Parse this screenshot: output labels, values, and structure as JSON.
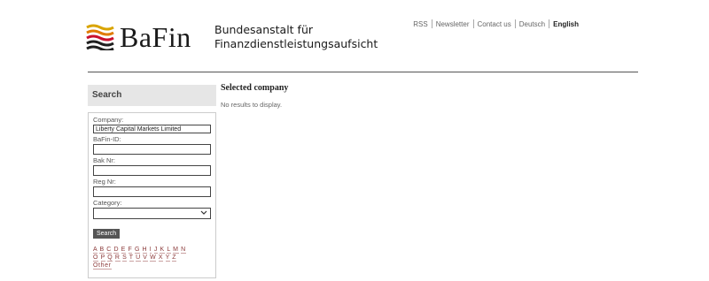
{
  "header": {
    "logo_word": "BaFin",
    "logo_sub_line1": "Bundesanstalt für",
    "logo_sub_line2": "Finanzdienstleistungsaufsicht",
    "nav": [
      "RSS",
      "Newsletter",
      "Contact us",
      "Deutsch",
      "English"
    ],
    "active_nav": "English"
  },
  "sidebar": {
    "title": "Search",
    "company_label": "Company:",
    "company_value": "Liberty Capital Markets Limited",
    "bafin_id_label": "BaFin-ID:",
    "bafin_id_value": "",
    "bak_label": "Bak Nr:",
    "bak_value": "",
    "reg_label": "Reg Nr:",
    "reg_value": "",
    "category_label": "Category:",
    "category_value": "",
    "search_button": "Search",
    "alphabet_row1": [
      "A",
      "B",
      "C",
      "D",
      "E",
      "F",
      "G",
      "H",
      "I",
      "J",
      "K",
      "L",
      "M",
      "N"
    ],
    "alphabet_row2": [
      "O",
      "P",
      "Q",
      "R",
      "S",
      "T",
      "U",
      "V",
      "W",
      "X",
      "Y",
      "Z"
    ],
    "other_link": "Other"
  },
  "main": {
    "title": "Selected company",
    "message": "No results to display."
  },
  "colors": {
    "link": "#8b3a3a",
    "button_bg": "#555555",
    "panel_bg": "#e6e6e6"
  }
}
